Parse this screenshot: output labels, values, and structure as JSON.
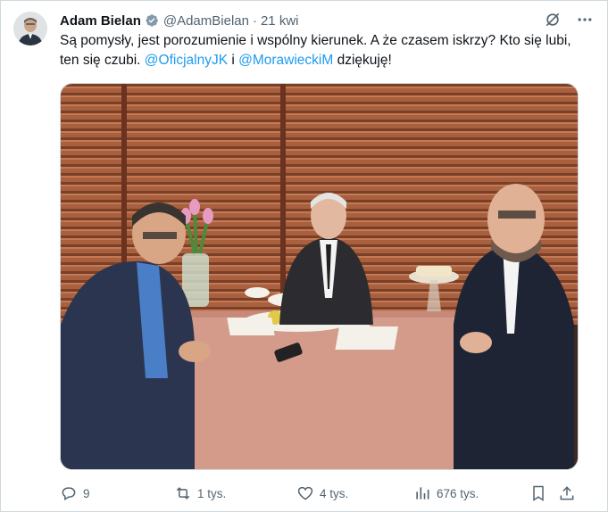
{
  "tweet": {
    "author_name": "Adam Bielan",
    "handle": "@AdamBielan",
    "separator": "·",
    "time": "21 kwi",
    "text_prefix": "Są pomysły, jest porozumienie i wspólny kierunek. A że czasem iskrzy? Kto się lubi, ten się czubi. ",
    "mention_1": "@OficjalnyJK",
    "text_middle": " i ",
    "mention_2": "@MorawieckiM",
    "text_suffix": " dziękuję!"
  },
  "actions": {
    "replies": "9",
    "reposts": "1 tys.",
    "likes": "4 tys.",
    "views": "676 tys."
  },
  "icons": {
    "verified": "verified-badge-icon",
    "grok": "grok-icon",
    "more": "more-icon",
    "reply": "reply-icon",
    "repost": "repost-icon",
    "like": "like-icon",
    "views": "views-icon",
    "bookmark": "bookmark-icon",
    "share": "share-icon"
  },
  "colors": {
    "link": "#1d9bf0",
    "secondary_text": "#536471",
    "verified_badge": "#829aab"
  }
}
